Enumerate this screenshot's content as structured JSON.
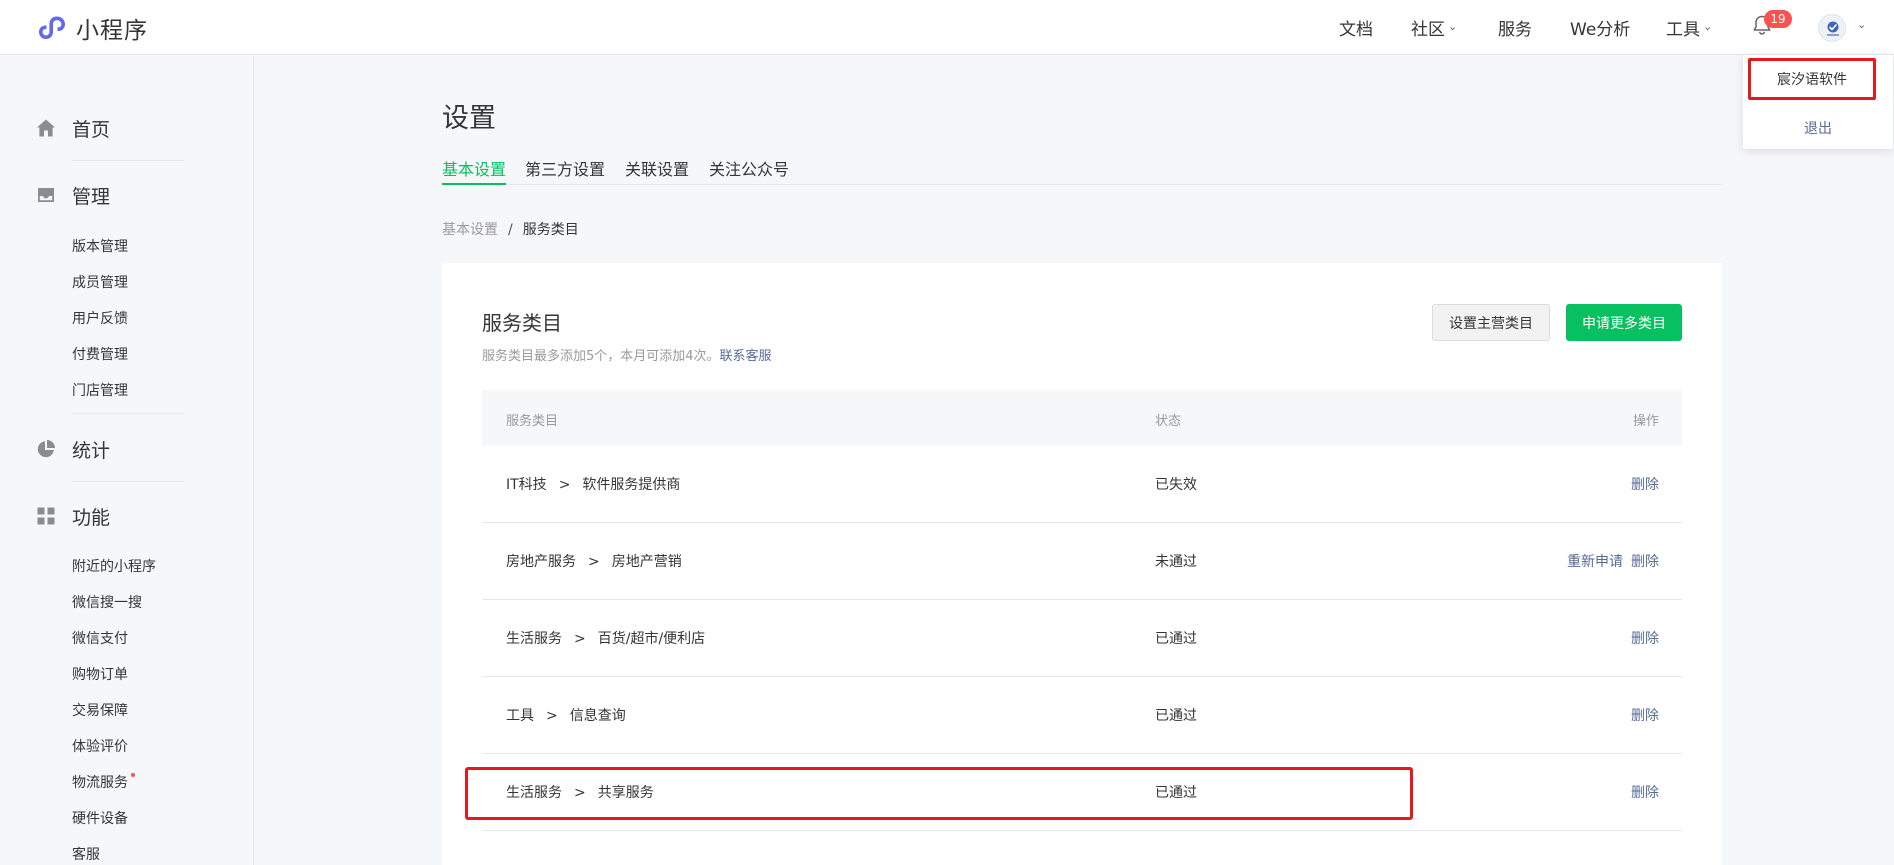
{
  "header": {
    "app_name": "小程序",
    "nav": [
      {
        "label": "文档",
        "has_dropdown": false
      },
      {
        "label": "社区",
        "has_dropdown": true
      },
      {
        "label": "服务",
        "has_dropdown": false
      },
      {
        "label": "We分析",
        "has_dropdown": false
      },
      {
        "label": "工具",
        "has_dropdown": true
      }
    ],
    "notification_count": "19",
    "icons": [
      "logo-icon",
      "bell-icon",
      "avatar",
      "chevron-down-icon"
    ]
  },
  "account_menu": {
    "account_name": "宸汐语软件",
    "logout_label": "退出"
  },
  "sidebar": {
    "sections": [
      {
        "label": "首页",
        "icon": "home-icon",
        "items": []
      },
      {
        "label": "管理",
        "icon": "inbox-icon",
        "items": [
          "版本管理",
          "成员管理",
          "用户反馈",
          "付费管理",
          "门店管理"
        ]
      },
      {
        "label": "统计",
        "icon": "pie-chart-icon",
        "items": []
      },
      {
        "label": "功能",
        "icon": "grid-icon",
        "items": [
          "附近的小程序",
          "微信搜一搜",
          "微信支付",
          "购物订单",
          "交易保障",
          "体验评价",
          "物流服务",
          "硬件设备",
          "客服"
        ]
      }
    ]
  },
  "page": {
    "title": "设置",
    "tabs": [
      "基本设置",
      "第三方设置",
      "关联设置",
      "关注公众号"
    ],
    "active_tab": "基本设置",
    "breadcrumb": {
      "parent": "基本设置",
      "separator": "/",
      "current": "服务类目"
    }
  },
  "service_category": {
    "title": "服务类目",
    "description": "服务类目最多添加5个，本月可添加4次。",
    "contact_link": "联系客服",
    "set_main_button": "设置主营类目",
    "apply_button": "申请更多类目",
    "columns": [
      "服务类目",
      "状态",
      "操作"
    ],
    "rows": [
      {
        "primary": "IT科技",
        "arrow": ">",
        "secondary": "软件服务提供商",
        "status": "已失效",
        "actions": [
          "删除"
        ]
      },
      {
        "primary": "房地产服务",
        "arrow": ">",
        "secondary": "房地产营销",
        "status": "未通过",
        "actions": [
          "重新申请",
          "删除"
        ]
      },
      {
        "primary": "生活服务",
        "arrow": ">",
        "secondary": "百货/超市/便利店",
        "status": "已通过",
        "actions": [
          "删除"
        ]
      },
      {
        "primary": "工具",
        "arrow": ">",
        "secondary": "信息查询",
        "status": "已通过",
        "actions": [
          "删除"
        ]
      },
      {
        "primary": "生活服务",
        "arrow": ">",
        "secondary": "共享服务",
        "status": "已通过",
        "actions": [
          "删除"
        ]
      }
    ]
  },
  "colors": {
    "accent_green": "#07c160",
    "link_blue": "#576b95",
    "badge_red": "#fa5151",
    "annotation_red": "#e8191d"
  }
}
